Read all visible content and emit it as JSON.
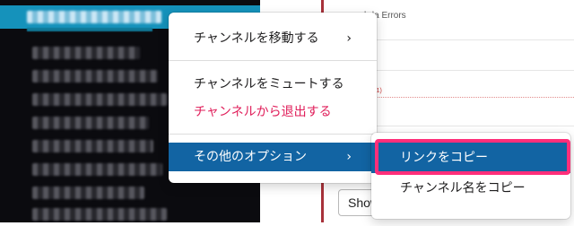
{
  "context_menu": {
    "items": [
      {
        "label": "チャンネルを移動する",
        "chevron": "›"
      },
      {
        "label": "チャンネルをミュートする"
      },
      {
        "label": "チャンネルから退出する"
      },
      {
        "label": "その他のオプション",
        "chevron": "›"
      }
    ]
  },
  "submenu": {
    "items": [
      {
        "label": "リンクをコピー"
      },
      {
        "label": "チャンネル名をコピー"
      }
    ]
  },
  "background": {
    "lambda_text": "bda Errors",
    "faint_number": "8x (1)",
    "show_button": "Show"
  },
  "colors": {
    "sidebar_bg": "#0b0b0f",
    "sidebar_active": "#1592bb",
    "menu_selected": "#1264a3",
    "danger_text": "#e01e5a",
    "highlight_border": "#ff2f7a",
    "accent_bar": "#a8323a"
  }
}
